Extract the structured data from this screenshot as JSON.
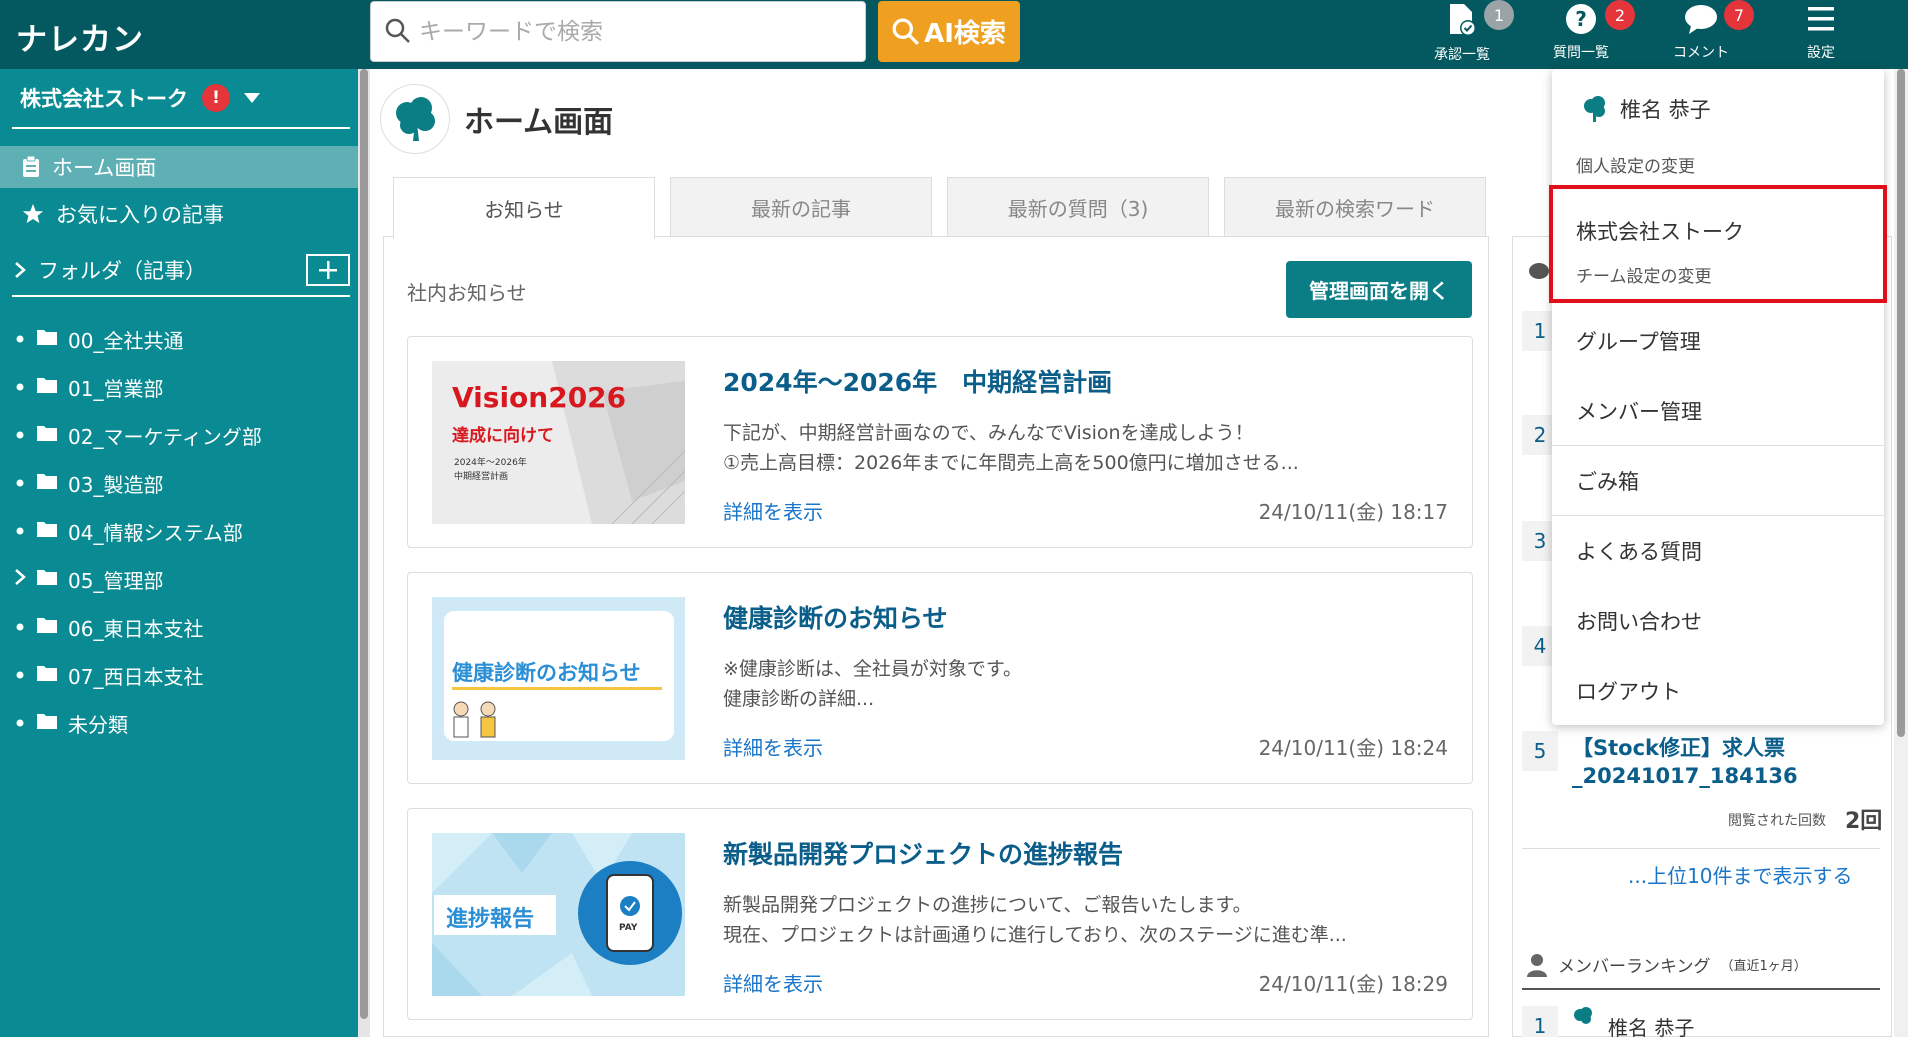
{
  "app": {
    "logo": "ナレカン"
  },
  "search": {
    "placeholder": "キーワードで検索",
    "ai_button": "AI検索"
  },
  "top_icons": [
    {
      "label": "承認一覧",
      "badge": "1",
      "badge_color": "#9aa3a6",
      "icon": "document-check-icon"
    },
    {
      "label": "質問一覧",
      "badge": "2",
      "badge_color": "#e5343a",
      "icon": "question-icon"
    },
    {
      "label": "コメント",
      "badge": "7",
      "badge_color": "#e5343a",
      "icon": "comment-icon"
    },
    {
      "label": "設定",
      "icon": "hamburger-menu-icon"
    }
  ],
  "sidebar": {
    "team_name": "株式会社ストーク",
    "alert": "!",
    "nav": [
      {
        "label": "ホーム画面",
        "icon": "clipboard-icon",
        "active": true
      },
      {
        "label": "お気に入りの記事",
        "icon": "star-icon",
        "active": false
      }
    ],
    "folder_header": "フォルダ（記事）",
    "folders": [
      {
        "label": "00_全社共通",
        "expandable": false
      },
      {
        "label": "01_営業部",
        "expandable": false
      },
      {
        "label": "02_マーケティング部",
        "expandable": false
      },
      {
        "label": "03_製造部",
        "expandable": false
      },
      {
        "label": "04_情報システム部",
        "expandable": false
      },
      {
        "label": "05_管理部",
        "expandable": true
      },
      {
        "label": "06_東日本支社",
        "expandable": false
      },
      {
        "label": "07_西日本支社",
        "expandable": false
      },
      {
        "label": "未分類",
        "expandable": false
      }
    ]
  },
  "main": {
    "title": "ホーム画面",
    "tabs": [
      {
        "label": "お知らせ",
        "active": true
      },
      {
        "label": "最新の記事",
        "active": false
      },
      {
        "label": "最新の質問（3)",
        "active": false
      },
      {
        "label": "最新の検索ワード",
        "active": false
      }
    ],
    "notice_label": "社内お知らせ",
    "admin_button": "管理画面を開く",
    "cards": [
      {
        "title": "2024年～2026年　中期経営計画",
        "line1": "下記が、中期経営計画なので、みんなでVisionを達成しよう！",
        "line2": "①売上高目標：2026年までに年間売上高を500億円に増加させる...",
        "more": "詳細を表示",
        "date": "24/10/11(金) 18:17",
        "thumb": {
          "big": "Vision2026",
          "sub": "達成に向けて",
          "small1": "2024年～2026年",
          "small2": "中期経営計画"
        }
      },
      {
        "title": "健康診断のお知らせ",
        "line1": "※健康診断は、全社員が対象です。",
        "line2": "健康診断の詳細...",
        "more": "詳細を表示",
        "date": "24/10/11(金) 18:24",
        "thumb": {
          "text": "健康診断のお知らせ"
        }
      },
      {
        "title": "新製品開発プロジェクトの進捗報告",
        "line1": "新製品開発プロジェクトの進捗について、ご報告いたします。",
        "line2": "現在、プロジェクトは計画通りに進行しており、次のステージに進む準...",
        "more": "詳細を表示",
        "date": "24/10/11(金) 18:29",
        "thumb": {
          "text": "進捗報告",
          "pay": "PAY"
        }
      }
    ]
  },
  "ranking": {
    "numbers": [
      "1",
      "2",
      "3",
      "4"
    ],
    "item5": {
      "num": "5",
      "title": "【Stock修正】求人票_20241017_184136",
      "view_label": "閲覧された回数",
      "views": "2回"
    },
    "show_top10": "...上位10件まで表示する",
    "member_ranking": "メンバーランキング",
    "member_ranking_sub": "（直近1ヶ月）",
    "member1_num": "1",
    "member1_name": "椎名 恭子"
  },
  "dropdown": {
    "user_name": "椎名 恭子",
    "personal_settings": "個人設定の変更",
    "team_name": "株式会社ストーク",
    "team_settings": "チーム設定の変更",
    "items": [
      "グループ管理",
      "メンバー管理",
      "ごみ箱",
      "よくある質問",
      "お問い合わせ",
      "ログアウト"
    ]
  },
  "colors": {
    "topbar": "#03595f",
    "sidebar": "#0a8a92",
    "accent": "#f0a020",
    "highlight": "#e0101a",
    "link": "#1976c8"
  }
}
